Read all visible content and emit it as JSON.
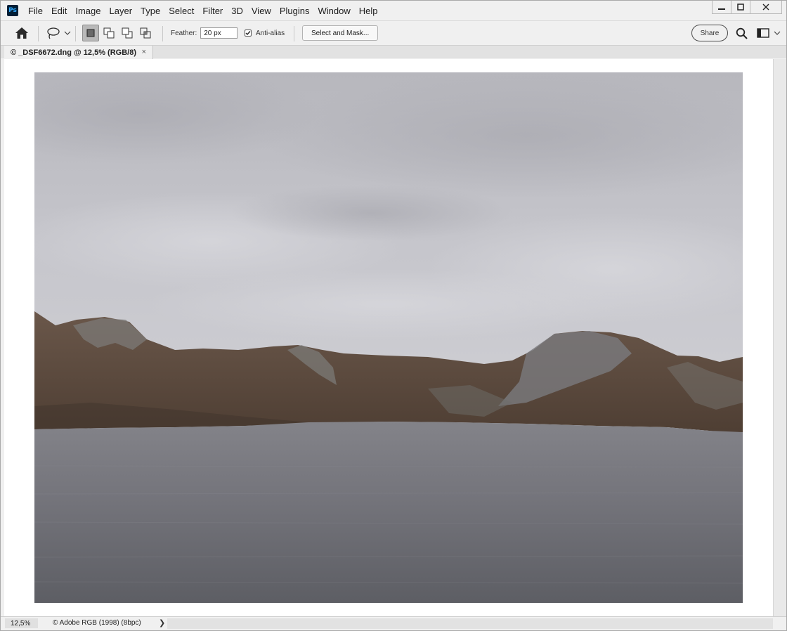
{
  "app": {
    "logo_text": "Ps"
  },
  "menu": {
    "items": [
      "File",
      "Edit",
      "Image",
      "Layer",
      "Type",
      "Select",
      "Filter",
      "3D",
      "View",
      "Plugins",
      "Window",
      "Help"
    ]
  },
  "window_controls": {
    "minimize_icon": "minimize-icon",
    "maximize_icon": "maximize-icon",
    "close_icon": "close-icon"
  },
  "options": {
    "home_icon": "home-icon",
    "tool_icon": "lasso-icon",
    "selection_modes": [
      "new-selection",
      "add-to-selection",
      "subtract-from-selection",
      "intersect-with-selection"
    ],
    "active_mode": "new-selection",
    "feather_label": "Feather:",
    "feather_value": "20 px",
    "antialias_label": "Anti-alias",
    "antialias_checked": true,
    "select_mask_label": "Select and Mask...",
    "share_label": "Share",
    "search_icon": "search-icon",
    "workspace_icon": "workspace-icon"
  },
  "document": {
    "tab_title": "© _DSF6672.dng @ 12,5% (RGB/8)",
    "close_symbol": "×"
  },
  "status": {
    "zoom": "12,5%",
    "info": "© Adobe RGB (1998) (8bpc)",
    "chevron": "❯"
  },
  "colors": {
    "chrome_bg": "#f0f0f0",
    "canvas_bg": "#ffffff",
    "sky": "#c4c4ca",
    "water": "#6e6e76",
    "hills": "#5e4a3c",
    "rocks": "#7a7b7c"
  }
}
